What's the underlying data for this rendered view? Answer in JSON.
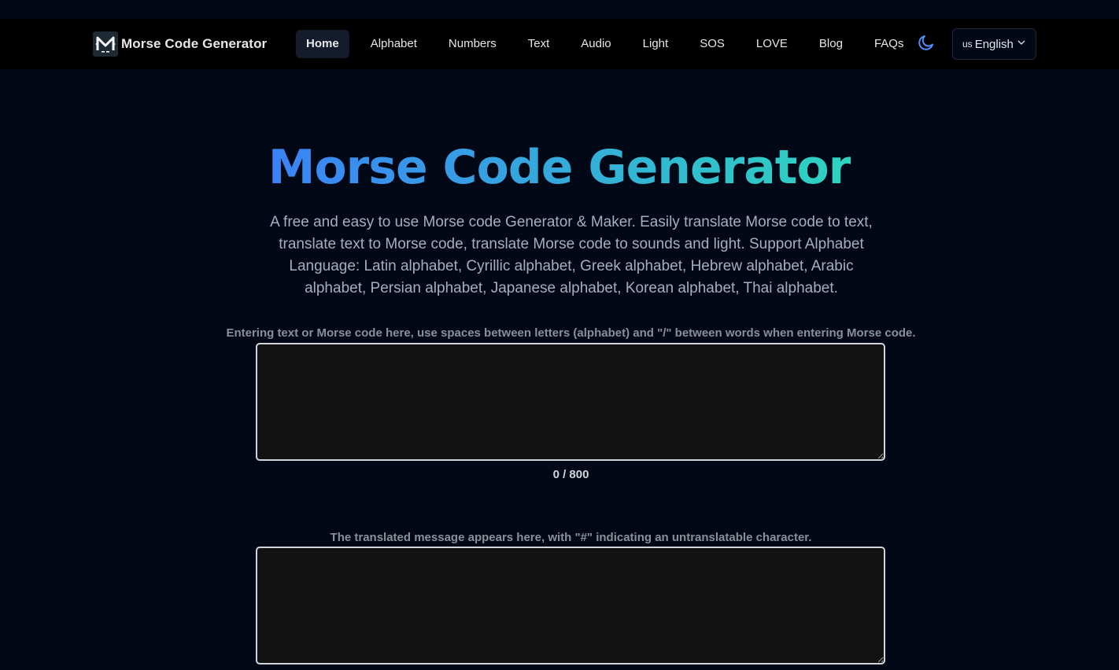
{
  "brand": {
    "name": "Morse Code Generator",
    "logo_icon": "morse-m-logo"
  },
  "nav": {
    "items": [
      {
        "label": "Home",
        "active": true
      },
      {
        "label": "Alphabet"
      },
      {
        "label": "Numbers"
      },
      {
        "label": "Text"
      },
      {
        "label": "Audio"
      },
      {
        "label": "Light"
      },
      {
        "label": "SOS"
      },
      {
        "label": "LOVE"
      },
      {
        "label": "Blog"
      },
      {
        "label": "FAQs"
      }
    ],
    "theme_toggle_icon": "moon-icon",
    "language": {
      "flag": "us",
      "label": "English"
    }
  },
  "hero": {
    "title": "Morse Code Generator",
    "description": "A free and easy to use Morse code Generator & Maker. Easily translate Morse code to text, translate text to Morse code, translate Morse code to sounds and light. Support Alphabet Language: Latin alphabet, Cyrillic alphabet, Greek alphabet, Hebrew alphabet, Arabic alphabet, Persian alphabet, Japanese alphabet, Korean alphabet, Thai alphabet.",
    "gradient": [
      "#3b82f6",
      "#2dd4bf"
    ]
  },
  "translator": {
    "input_hint": "Entering text or Morse code here, use spaces between letters (alphabet) and \"/\" between words when entering Morse code.",
    "input_value": "",
    "counter": "0 / 800",
    "output_hint": "The translated message appears here, with \"#\" indicating an untranslatable character.",
    "output_value": ""
  },
  "colors": {
    "background": "#030817",
    "navbar": "#000000",
    "textbox_bg": "#121212",
    "accent": "#3b82f6"
  }
}
